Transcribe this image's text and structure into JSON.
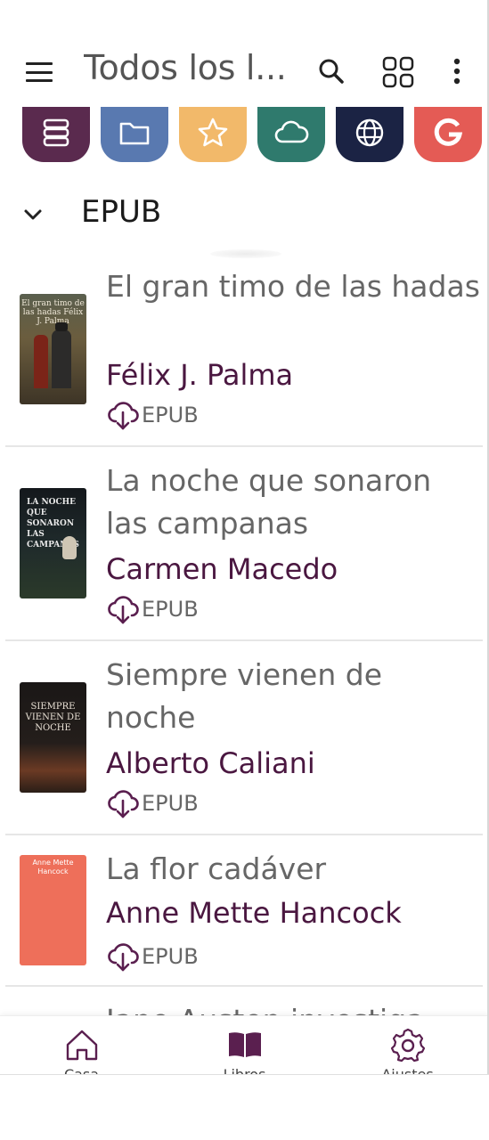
{
  "header": {
    "title": "Todos los l...",
    "menu_icon": "hamburger-menu-icon",
    "search_icon": "search-icon",
    "grid_icon": "grid-view-icon",
    "more_icon": "more-vert-icon"
  },
  "sources": [
    {
      "icon": "library-books-icon",
      "color": "#5a2a4e"
    },
    {
      "icon": "folder-icon",
      "color": "#5979b0"
    },
    {
      "icon": "star-icon",
      "color": "#f2b96a"
    },
    {
      "icon": "cloud-icon",
      "color": "#2f7a6d"
    },
    {
      "icon": "globe-icon",
      "color": "#1b2344"
    },
    {
      "icon": "google-icon",
      "color": "#e45b55"
    }
  ],
  "section": {
    "label": "EPUB",
    "chevron_icon": "chevron-down-icon"
  },
  "books": [
    {
      "title": "El gran timo de las hadas",
      "author": "Félix J. Palma",
      "format": "EPUB",
      "cover_text": "El gran timo de las hadas Félix J. Palma"
    },
    {
      "title": "La noche que sonaron las campanas",
      "author": "Carmen Macedo",
      "format": "EPUB",
      "cover_text": "LA NOCHE QUE SONARON LAS CAMPANAS"
    },
    {
      "title": "Siempre vienen de noche",
      "author": "Alberto Caliani",
      "format": "EPUB",
      "cover_text": "SIEMPRE VIENEN DE NOCHE"
    },
    {
      "title": "La flor cadáver",
      "author": "Anne Mette Hancock",
      "format": "EPUB",
      "cover_text": "Anne Mette Hancock"
    },
    {
      "title": "Jane Austen investiga",
      "author": "",
      "format": ""
    }
  ],
  "bottom_nav": [
    {
      "label": "Casa",
      "icon": "home-icon"
    },
    {
      "label": "Libros",
      "icon": "book-open-icon"
    },
    {
      "label": "Ajustes",
      "icon": "settings-gear-icon"
    }
  ],
  "colors": {
    "accent": "#4a1740",
    "title_text": "#666666"
  }
}
